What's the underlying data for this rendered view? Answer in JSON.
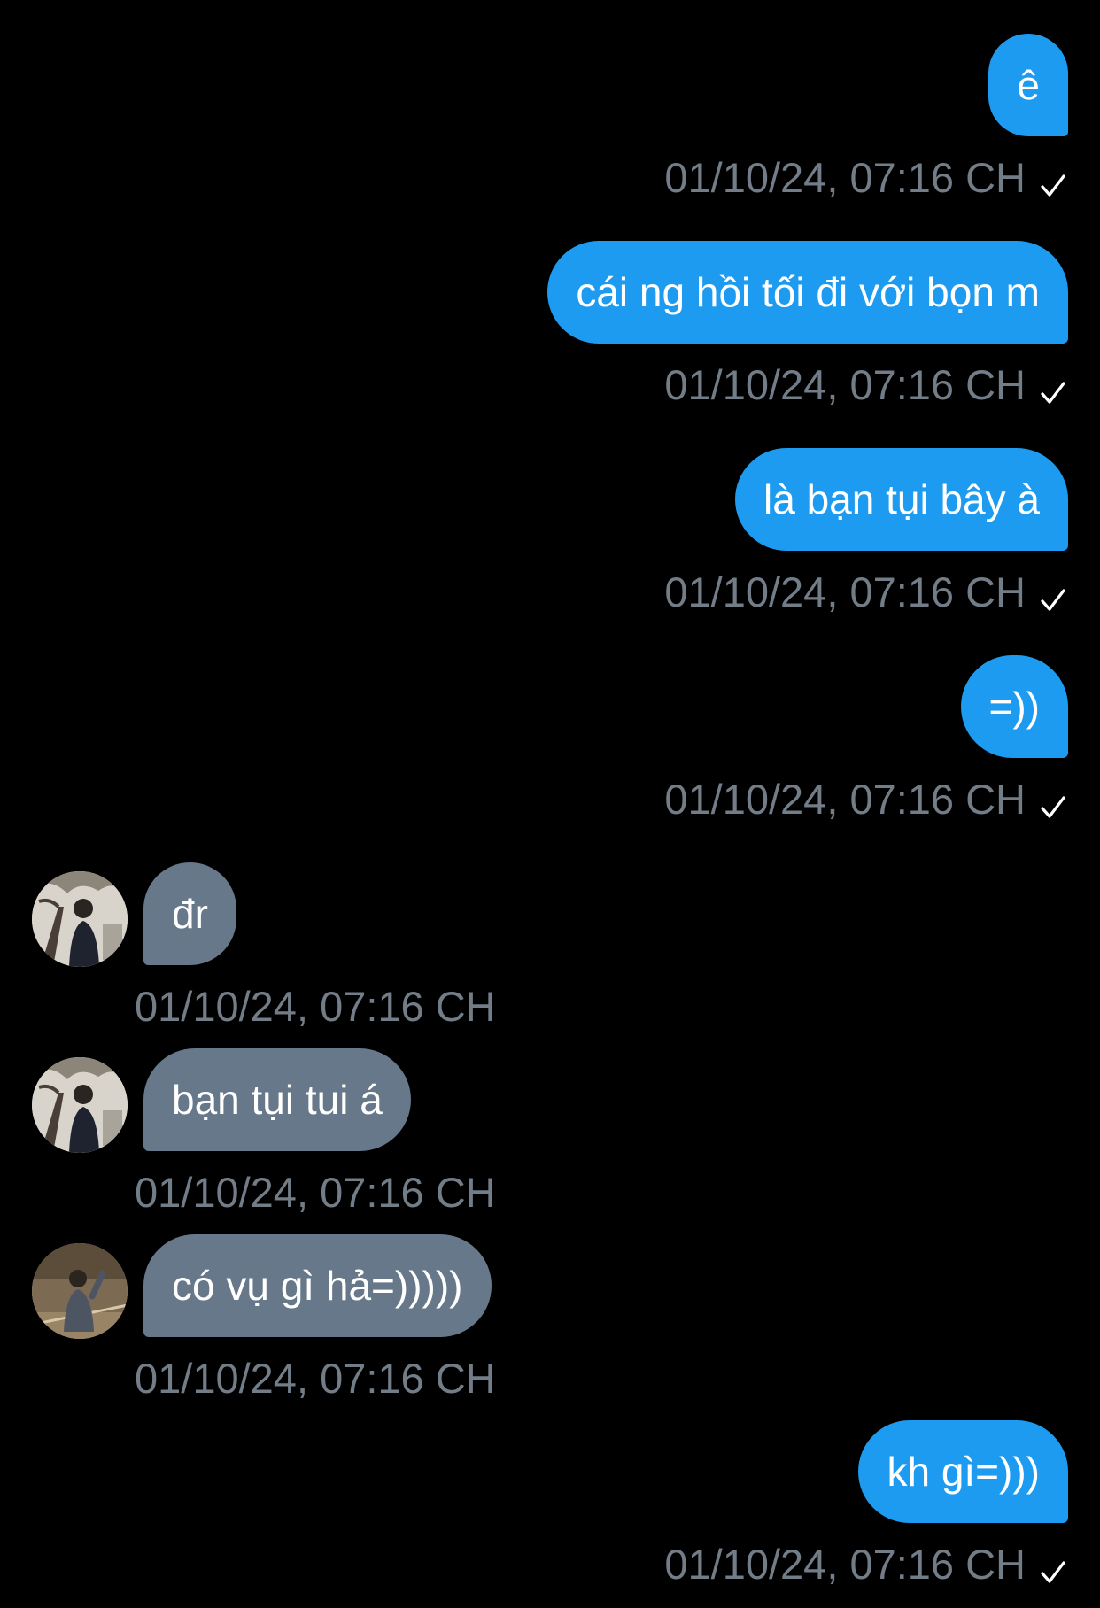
{
  "conversation": {
    "messages": [
      {
        "direction": "outgoing",
        "text": "ê",
        "timestamp": "01/10/24, 07:16 CH",
        "status_icon": "check-icon"
      },
      {
        "direction": "outgoing",
        "text": "cái ng hồi tối đi với bọn m",
        "timestamp": "01/10/24, 07:16 CH",
        "status_icon": "check-icon"
      },
      {
        "direction": "outgoing",
        "text": "là bạn tụi bây à",
        "timestamp": "01/10/24, 07:16 CH",
        "status_icon": "check-icon"
      },
      {
        "direction": "outgoing",
        "text": "=))",
        "timestamp": "01/10/24, 07:16 CH",
        "status_icon": "check-icon"
      },
      {
        "direction": "incoming",
        "text": "đr",
        "timestamp": "01/10/24, 07:16 CH",
        "avatar": "avatar-photo-1"
      },
      {
        "direction": "incoming",
        "text": "bạn tụi tui á",
        "timestamp": "01/10/24, 07:16 CH",
        "avatar": "avatar-photo-1"
      },
      {
        "direction": "incoming",
        "text": "có vụ gì hả=)))))",
        "timestamp": "01/10/24, 07:16 CH",
        "avatar": "avatar-photo-2"
      },
      {
        "direction": "outgoing",
        "text": "kh gì=)))",
        "timestamp": "01/10/24, 07:16 CH",
        "status_icon": "check-icon"
      }
    ]
  },
  "colors": {
    "background": "#000000",
    "outgoing_bubble": "#1d9bf0",
    "incoming_bubble": "#67788a",
    "timestamp_text": "#727d88",
    "message_text": "#ffffff"
  }
}
